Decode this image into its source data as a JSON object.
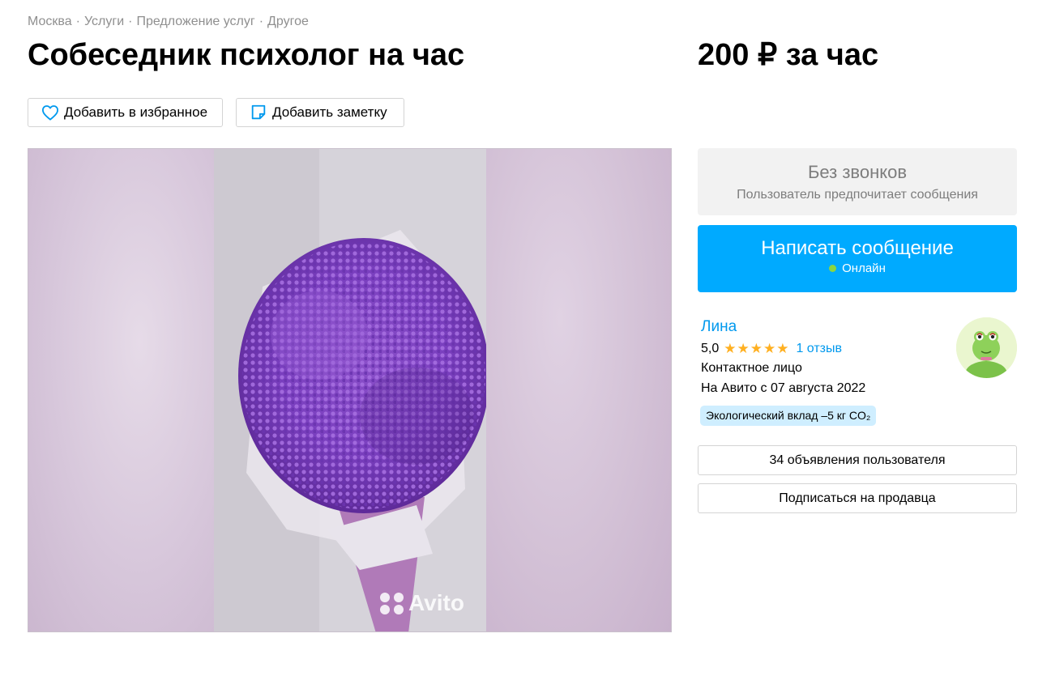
{
  "breadcrumb": [
    "Москва",
    "Услуги",
    "Предложение услуг",
    "Другое"
  ],
  "breadcrumb_separator": "·",
  "listing": {
    "title": "Собеседник психолог на час",
    "price": "200 ₽ за час"
  },
  "actions": {
    "favorite_label": "Добавить в избранное",
    "note_label": "Добавить заметку"
  },
  "gallery": {
    "watermark": "Avito",
    "image_subject": "purple gypsophila bouquet"
  },
  "contact": {
    "no_calls_title": "Без звонков",
    "no_calls_subtitle": "Пользователь предпочитает сообщения",
    "message_button": "Написать сообщение",
    "online_status": "Онлайн"
  },
  "seller": {
    "name": "Лина",
    "rating": "5,0",
    "stars": "★★★★★",
    "reviews": "1 отзыв",
    "role": "Контактное лицо",
    "since": "На Авито с 07 августа 2022",
    "eco_badge": "Экологический вклад –5 кг CO₂",
    "listings_button": "34 объявления пользователя",
    "subscribe_button": "Подписаться на продавца"
  },
  "colors": {
    "accent": "#00aaff",
    "link": "#0099ee",
    "star": "#ffb021",
    "online": "#8bd641",
    "eco_badge_bg": "#cfeeff"
  }
}
